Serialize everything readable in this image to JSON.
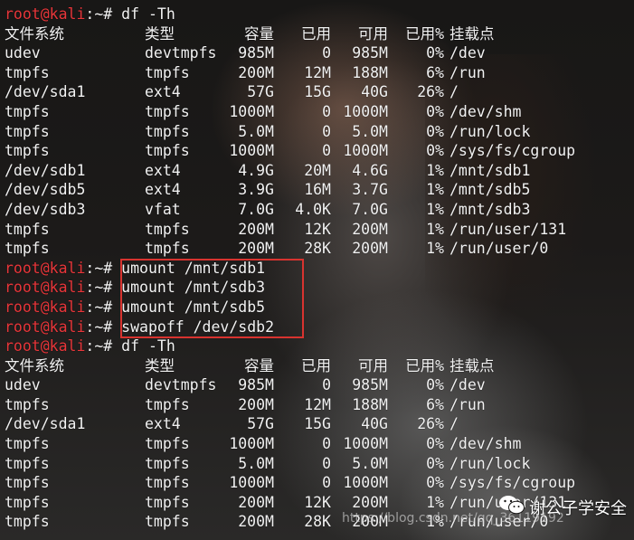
{
  "prompt": {
    "user_host": "root@kali",
    "path": ":~# "
  },
  "header": {
    "fs": "文件系统",
    "type": "类型",
    "size": "容量",
    "used": "已用",
    "avail": "可用",
    "pct": "已用%",
    "mount": "挂载点"
  },
  "first": {
    "command": "df -Th",
    "rows": [
      {
        "fs": "udev",
        "type": "devtmpfs",
        "size": "985M",
        "used": "0",
        "avail": "985M",
        "pct": "0%",
        "mount": "/dev"
      },
      {
        "fs": "tmpfs",
        "type": "tmpfs",
        "size": "200M",
        "used": "12M",
        "avail": "188M",
        "pct": "6%",
        "mount": "/run"
      },
      {
        "fs": "/dev/sda1",
        "type": "ext4",
        "size": "57G",
        "used": "15G",
        "avail": "40G",
        "pct": "26%",
        "mount": "/"
      },
      {
        "fs": "tmpfs",
        "type": "tmpfs",
        "size": "1000M",
        "used": "0",
        "avail": "1000M",
        "pct": "0%",
        "mount": "/dev/shm"
      },
      {
        "fs": "tmpfs",
        "type": "tmpfs",
        "size": "5.0M",
        "used": "0",
        "avail": "5.0M",
        "pct": "0%",
        "mount": "/run/lock"
      },
      {
        "fs": "tmpfs",
        "type": "tmpfs",
        "size": "1000M",
        "used": "0",
        "avail": "1000M",
        "pct": "0%",
        "mount": "/sys/fs/cgroup"
      },
      {
        "fs": "/dev/sdb1",
        "type": "ext4",
        "size": "4.9G",
        "used": "20M",
        "avail": "4.6G",
        "pct": "1%",
        "mount": "/mnt/sdb1"
      },
      {
        "fs": "/dev/sdb5",
        "type": "ext4",
        "size": "3.9G",
        "used": "16M",
        "avail": "3.7G",
        "pct": "1%",
        "mount": "/mnt/sdb5"
      },
      {
        "fs": "/dev/sdb3",
        "type": "vfat",
        "size": "7.0G",
        "used": "4.0K",
        "avail": "7.0G",
        "pct": "1%",
        "mount": "/mnt/sdb3"
      },
      {
        "fs": "tmpfs",
        "type": "tmpfs",
        "size": "200M",
        "used": "12K",
        "avail": "200M",
        "pct": "1%",
        "mount": "/run/user/131"
      },
      {
        "fs": "tmpfs",
        "type": "tmpfs",
        "size": "200M",
        "used": "28K",
        "avail": "200M",
        "pct": "1%",
        "mount": "/run/user/0"
      }
    ]
  },
  "commands": [
    "umount /mnt/sdb1",
    "umount /mnt/sdb3",
    "umount /mnt/sdb5",
    "swapoff /dev/sdb2"
  ],
  "second": {
    "command": "df -Th",
    "rows": [
      {
        "fs": "udev",
        "type": "devtmpfs",
        "size": "985M",
        "used": "0",
        "avail": "985M",
        "pct": "0%",
        "mount": "/dev"
      },
      {
        "fs": "tmpfs",
        "type": "tmpfs",
        "size": "200M",
        "used": "12M",
        "avail": "188M",
        "pct": "6%",
        "mount": "/run"
      },
      {
        "fs": "/dev/sda1",
        "type": "ext4",
        "size": "57G",
        "used": "15G",
        "avail": "40G",
        "pct": "26%",
        "mount": "/"
      },
      {
        "fs": "tmpfs",
        "type": "tmpfs",
        "size": "1000M",
        "used": "0",
        "avail": "1000M",
        "pct": "0%",
        "mount": "/dev/shm"
      },
      {
        "fs": "tmpfs",
        "type": "tmpfs",
        "size": "5.0M",
        "used": "0",
        "avail": "5.0M",
        "pct": "0%",
        "mount": "/run/lock"
      },
      {
        "fs": "tmpfs",
        "type": "tmpfs",
        "size": "1000M",
        "used": "0",
        "avail": "1000M",
        "pct": "0%",
        "mount": "/sys/fs/cgroup"
      },
      {
        "fs": "tmpfs",
        "type": "tmpfs",
        "size": "200M",
        "used": "12K",
        "avail": "200M",
        "pct": "1%",
        "mount": "/run/user/131"
      },
      {
        "fs": "tmpfs",
        "type": "tmpfs",
        "size": "200M",
        "used": "28K",
        "avail": "200M",
        "pct": "1%",
        "mount": "/run/user/0"
      }
    ]
  },
  "watermark": "https://blog.csdn.net/qq_36119192",
  "badge": {
    "icon": "wechat-icon",
    "label": "谢公子学安全"
  },
  "colors": {
    "prompt": "#e8363a",
    "text": "#f2f2f2",
    "highlight": "#d8332f"
  }
}
